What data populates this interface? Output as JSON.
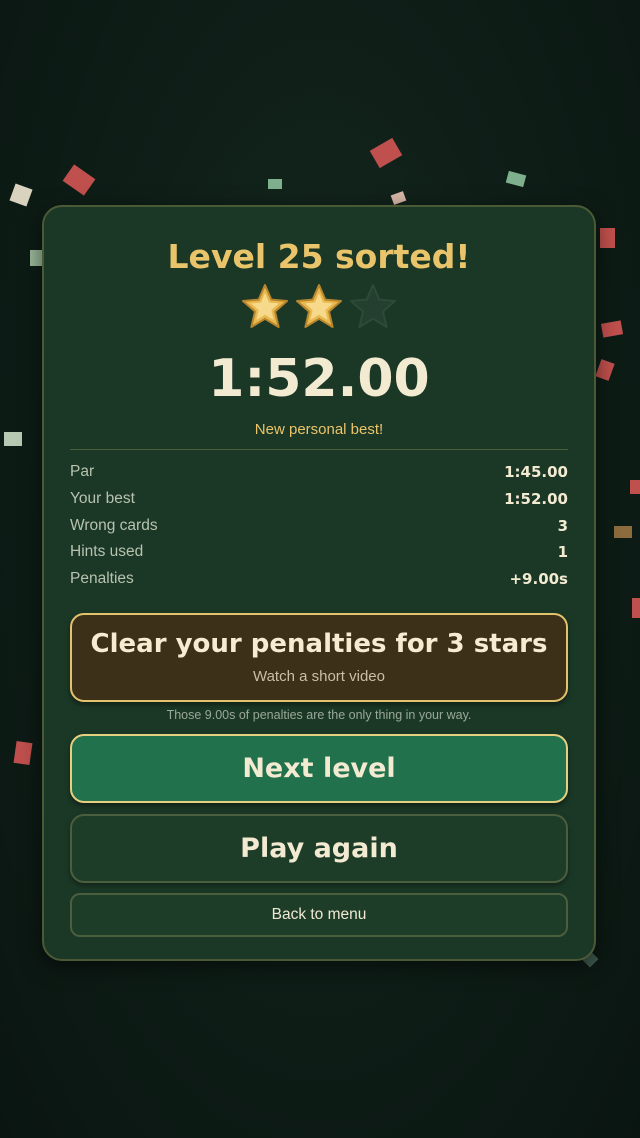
{
  "result": {
    "title": "Level 25 sorted!",
    "stars_earned": 2,
    "stars_total": 3,
    "time": "1:52.00",
    "note": "New personal best!"
  },
  "stats": [
    {
      "label": "Par",
      "value": "1:45.00"
    },
    {
      "label": "Your best",
      "value": "1:52.00"
    },
    {
      "label": "Wrong cards",
      "value": "3"
    },
    {
      "label": "Hints used",
      "value": "1"
    },
    {
      "label": "Penalties",
      "value": "+9.00s"
    }
  ],
  "actions": {
    "clear_penalties_label": "Clear your penalties for 3 stars",
    "clear_penalties_sub": "Watch a short video",
    "penalty_hint": "Those 9.00s of penalties are the only thing in your way.",
    "next_level": "Next level",
    "play_again": "Play again",
    "back_to_menu": "Back to menu"
  },
  "colors": {
    "background": "#0f1f18",
    "panel": "#1b3826",
    "accent_gold": "#e9c46a",
    "primary_button": "#21724c",
    "penalty_button": "#3d3018",
    "confetti": [
      "#c0504d",
      "#7fb08e",
      "#d9d2bf",
      "#8c6b3e"
    ]
  },
  "icons": {
    "star_filled": "star-icon",
    "star_empty": "star-empty-icon"
  }
}
